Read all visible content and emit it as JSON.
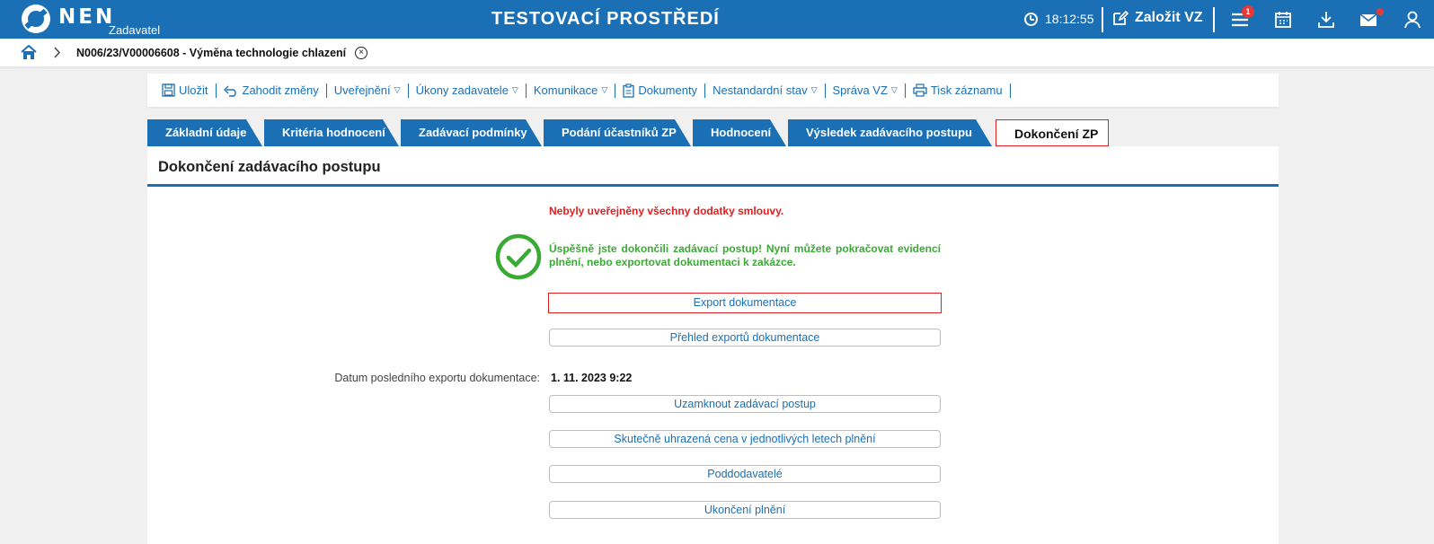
{
  "app": {
    "logo_text": "NEN",
    "logo_sub": "Zadavatel",
    "environment": "TESTOVACÍ PROSTŘEDÍ",
    "time": "18:12:55",
    "create_vz": "Založit VZ",
    "notification_count": "1"
  },
  "breadcrumb": {
    "title": "N006/23/V00006608 - Výměna technologie chlazení"
  },
  "toolbar": {
    "items": [
      {
        "label": "Uložit",
        "icon": "save-icon",
        "dropdown": false
      },
      {
        "label": "Zahodit změny",
        "icon": "undo-icon",
        "dropdown": false
      },
      {
        "label": "Uveřejnění",
        "icon": "",
        "dropdown": true
      },
      {
        "label": "Úkony zadavatele",
        "icon": "",
        "dropdown": true
      },
      {
        "label": "Komunikace",
        "icon": "",
        "dropdown": true
      },
      {
        "label": "Dokumenty",
        "icon": "clipboard-icon",
        "dropdown": false
      },
      {
        "label": "Nestandardní stav",
        "icon": "",
        "dropdown": true
      },
      {
        "label": "Správa VZ",
        "icon": "",
        "dropdown": true
      },
      {
        "label": "Tisk záznamu",
        "icon": "print-icon",
        "dropdown": false
      }
    ],
    "dropdown_glyph": "▽"
  },
  "tabs": [
    "Základní údaje",
    "Kritéria hodnocení",
    "Zadávací podmínky",
    "Podání účastníků ZP",
    "Hodnocení",
    "Výsledek zadávacího postupu",
    "Dokončení ZP"
  ],
  "main": {
    "section_title": "Dokončení zadávacího postupu",
    "warning": "Nebyly uveřejněny všechny dodatky smlouvy.",
    "success": "Úspěšně jste dokončili zadávací postup! Nyní můžete pokračovat evidencí plnění, nebo exportovat dokumentaci k zakázce.",
    "export_button": "Export dokumentace",
    "export_overview_button": "Přehled exportů dokumentace",
    "last_export_label": "Datum posledního exportu dokumentace:",
    "last_export_value": "1. 11. 2023 9:22",
    "lock_button": "Uzamknout zadávací postup",
    "price_button": "Skutečně uhrazená cena v jednotlivých letech plnění",
    "subcontractors_button": "Poddodavatelé",
    "end_button": "Ukončení plnění"
  },
  "colors": {
    "primary": "#1b6fb5",
    "warning": "#e02020",
    "success": "#3aaa35"
  }
}
